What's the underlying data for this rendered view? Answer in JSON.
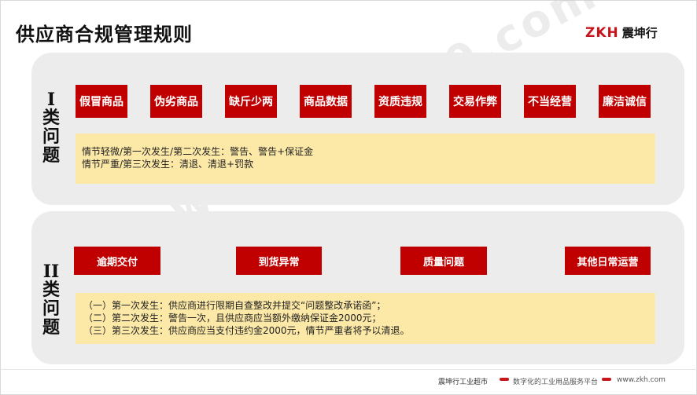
{
  "title": "供应商合规管理规则",
  "logo": {
    "mark": "ZKH",
    "text": "震坤行"
  },
  "class1": {
    "label": [
      "I",
      "类",
      "问",
      "题"
    ],
    "tags": [
      "假冒商品",
      "伪劣商品",
      "缺斤少两",
      "商品数据",
      "资质违规",
      "交易作弊",
      "不当经营",
      "廉洁诚信"
    ],
    "notes": [
      "情节轻微/第一次发生/第二次发生：警告、警告+保证金",
      "情节严重/第三次发生：清退、清退+罚款"
    ]
  },
  "class2": {
    "label": [
      "II",
      "类",
      "问",
      "题"
    ],
    "tags": [
      "逾期交付",
      "到货异常",
      "质量问题",
      "其他日常运营"
    ],
    "notes": [
      "（一）第一次发生：供应商进行限期自查整改并提交“问题整改承诺函”；",
      "（二）第二次发生：警告一次，且供应商应当额外缴纳保证金2000元；",
      "（三）第三次发生：供应商应当支付违约金2000元，情节严重者将予以清退。"
    ]
  },
  "watermark": "www.zkh360.com",
  "footer": {
    "brand": "震坤行工业超市",
    "slogan": "数字化的工业用品服务平台",
    "url": "www.zkh.com"
  },
  "colors": {
    "accent": "#c00000",
    "note_bg": "#fde9a7",
    "panel_bg": "#ececec"
  }
}
